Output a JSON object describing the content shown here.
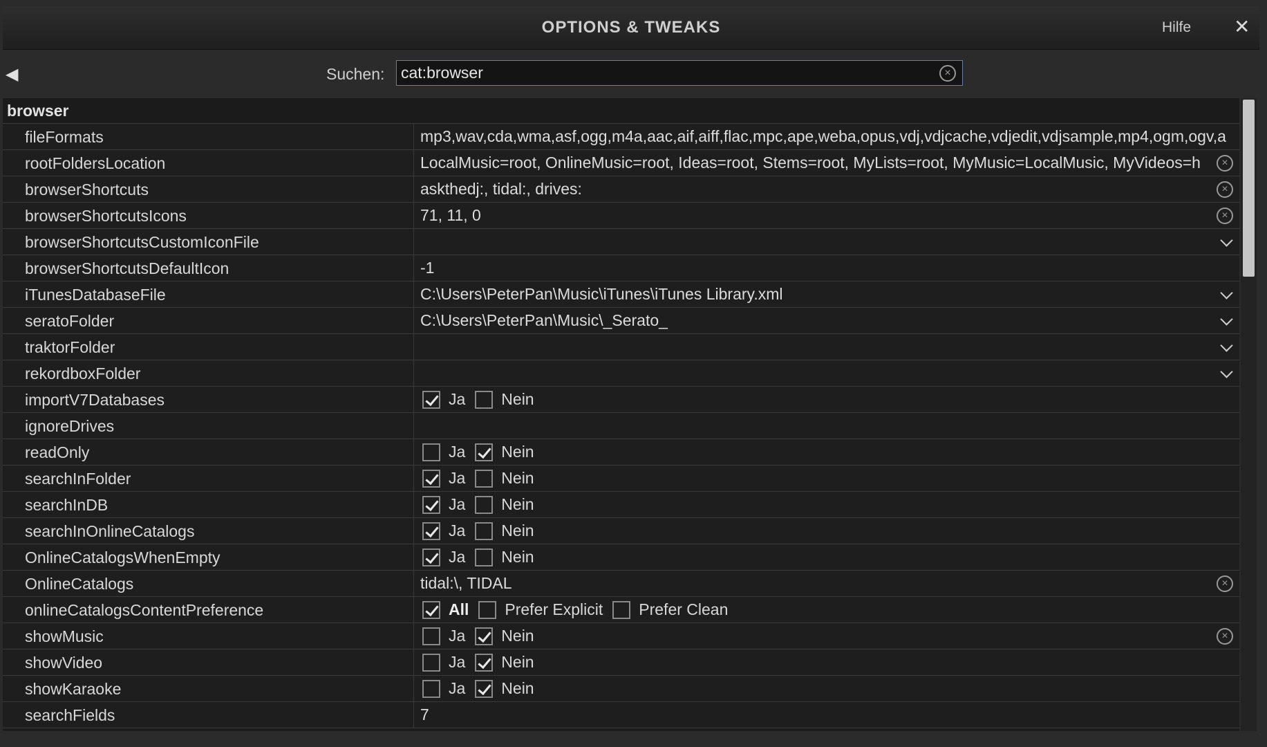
{
  "window": {
    "title": "OPTIONS & TWEAKS",
    "help_label": "Hilfe",
    "close_label": "✕"
  },
  "search": {
    "label": "Suchen:",
    "value": "cat:browser"
  },
  "category": "browser",
  "rows": [
    {
      "name": "fileFormats",
      "value": "mp3,wav,cda,wma,asf,ogg,m4a,aac,aif,aiff,flac,mpc,ape,weba,opus,vdj,vdjcache,vdjedit,vdjsample,mp4,ogm,ogv,a"
    },
    {
      "name": "rootFoldersLocation",
      "value": "LocalMusic=root, OnlineMusic=root, Ideas=root, Stems=root, MyLists=root, MyMusic=LocalMusic, MyVideos=h"
    },
    {
      "name": "browserShortcuts",
      "value": "askthedj:, tidal:, drives:"
    },
    {
      "name": "browserShortcutsIcons",
      "value": "71, 11, 0"
    },
    {
      "name": "browserShortcutsCustomIconFile",
      "value": ""
    },
    {
      "name": "browserShortcutsDefaultIcon",
      "value": "-1"
    },
    {
      "name": "iTunesDatabaseFile",
      "value": "C:\\Users\\PeterPan\\Music\\iTunes\\iTunes Library.xml"
    },
    {
      "name": "seratoFolder",
      "value": "C:\\Users\\PeterPan\\Music\\_Serato_"
    },
    {
      "name": "traktorFolder",
      "value": ""
    },
    {
      "name": "rekordboxFolder",
      "value": ""
    },
    {
      "name": "importV7Databases"
    },
    {
      "name": "ignoreDrives",
      "value": ""
    },
    {
      "name": "readOnly"
    },
    {
      "name": "searchInFolder"
    },
    {
      "name": "searchInDB"
    },
    {
      "name": "searchInOnlineCatalogs"
    },
    {
      "name": "OnlineCatalogsWhenEmpty"
    },
    {
      "name": "OnlineCatalogs",
      "value": "tidal:\\, TIDAL"
    },
    {
      "name": "onlineCatalogsContentPreference"
    },
    {
      "name": "showMusic"
    },
    {
      "name": "showVideo"
    },
    {
      "name": "showKaraoke"
    },
    {
      "name": "searchFields",
      "value": "7"
    }
  ],
  "options": {
    "yes": "Ja",
    "no": "Nein",
    "all": "All",
    "prefer_explicit": "Prefer Explicit",
    "prefer_clean": "Prefer Clean"
  },
  "checked": {
    "importV7Databases": "Ja",
    "readOnly": "Nein",
    "searchInFolder": "Ja",
    "searchInDB": "Ja",
    "searchInOnlineCatalogs": "Ja",
    "OnlineCatalogsWhenEmpty": "Ja",
    "onlineCatalogsContentPreference": "All",
    "showMusic": "Nein",
    "showVideo": "Nein",
    "showKaraoke": "Nein"
  },
  "icons": {
    "back": "back-arrow-icon",
    "clear": "clear-circle-icon",
    "dropdown": "chevron-down-icon",
    "check": "checkmark-icon"
  },
  "colors": {
    "background": "#2b2b2b",
    "grid": "#1e1e1e",
    "search_border": "#6b7fa3",
    "thumb": "#c6c6c6"
  }
}
